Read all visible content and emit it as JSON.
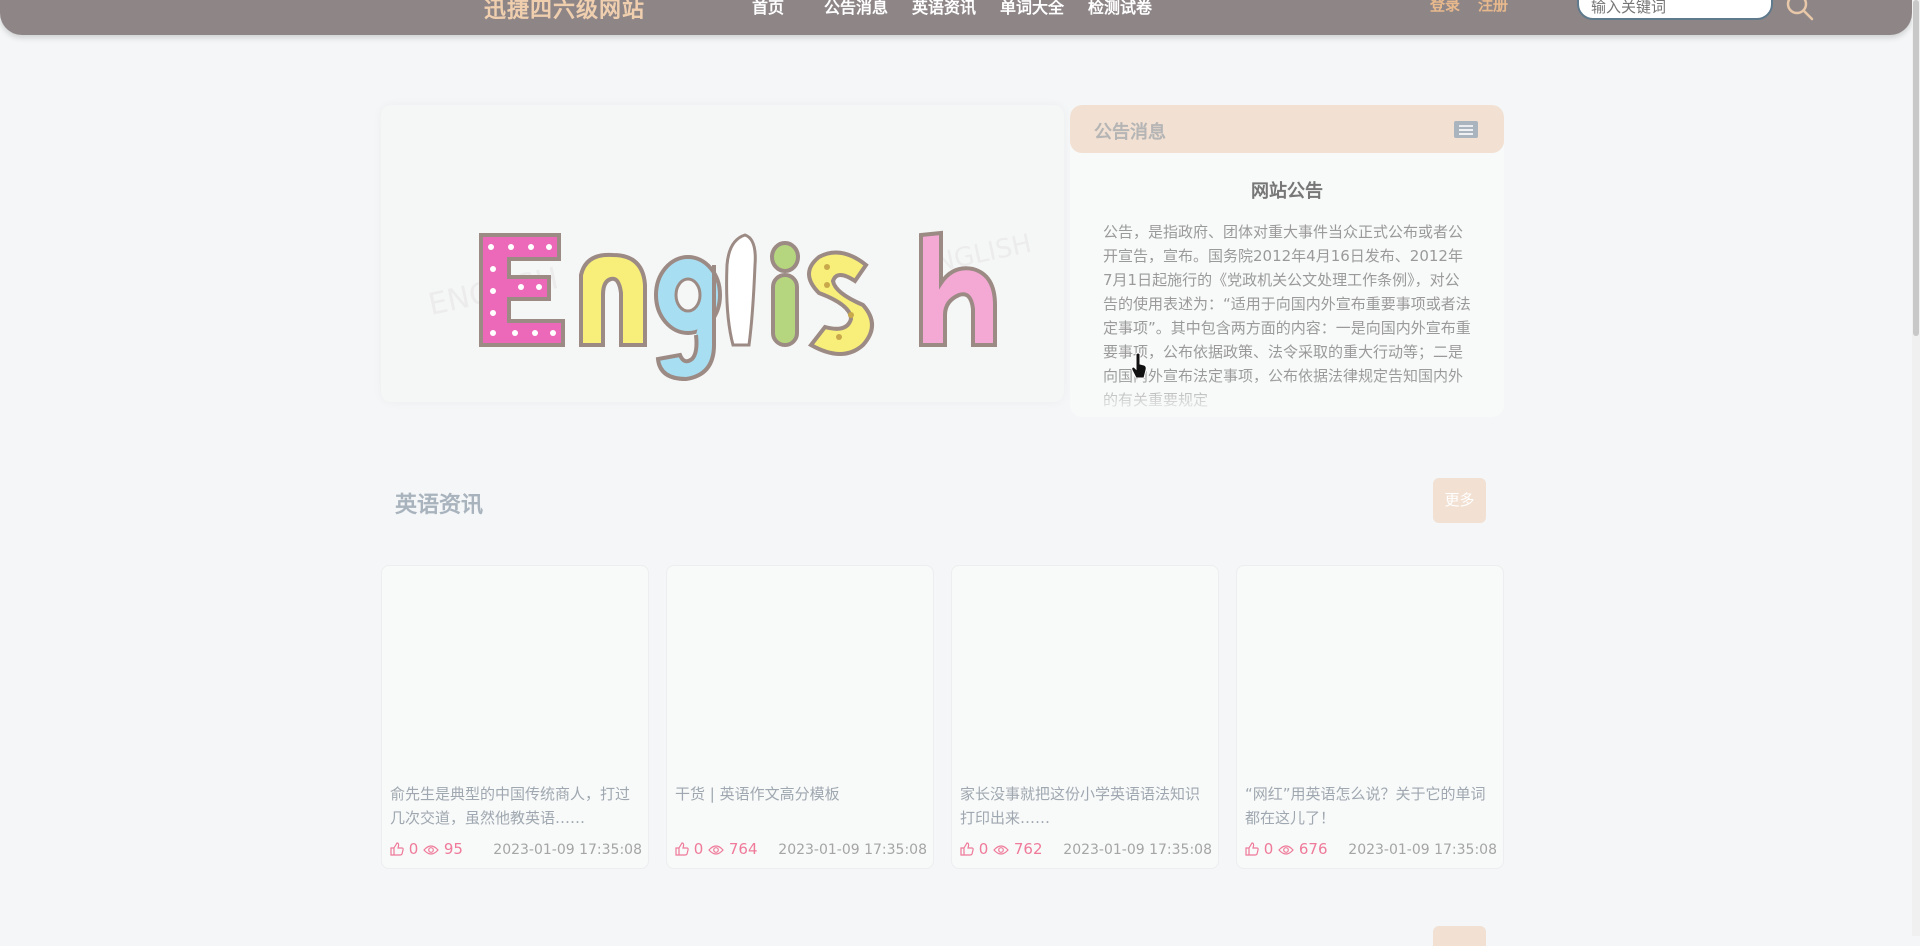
{
  "header": {
    "brand": "迅捷四六级网站",
    "nav": [
      {
        "label": "首页"
      },
      {
        "label": "公告消息"
      },
      {
        "label": "英语资讯"
      },
      {
        "label": "单词大全"
      },
      {
        "label": "检测试卷"
      }
    ],
    "login_label": "登录",
    "register_label": "注册",
    "search_placeholder": "输入关键词"
  },
  "banner": {
    "image_text": "English"
  },
  "notice_panel": {
    "heading": "公告消息",
    "more_icon": "more-icon",
    "title": "网站公告",
    "body": "公告，是指政府、团体对重大事件当众正式公布或者公开宣告，宣布。国务院2012年4月16日发布、2012年7月1日起施行的《党政机关公文处理工作条例》，对公告的使用表述为：“适用于向国内外宣布重要事项或者法定事项”。其中包含两方面的内容：一是向国内外宣布重要事项，公布依据政策、法令采取的重大行动等；二是向国内外宣布法定事项，公布依据法律规定告知国内外的有关重要规定"
  },
  "news_section": {
    "title": "英语资讯",
    "more_label": "更多",
    "cards": [
      {
        "title": "俞先生是典型的中国传统商人，打过几次交道，虽然他教英语……",
        "likes": "0",
        "views": "95",
        "date": "2023-01-09 17:35:08"
      },
      {
        "title": "干货 | 英语作文高分模板",
        "likes": "0",
        "views": "764",
        "date": "2023-01-09 17:35:08"
      },
      {
        "title": "家长没事就把这份小学英语语法知识打印出来……",
        "likes": "0",
        "views": "762",
        "date": "2023-01-09 17:35:08"
      },
      {
        "title": "“网红”用英语怎么说？关于它的单词都在这儿了！",
        "likes": "0",
        "views": "676",
        "date": "2023-01-09 17:35:08"
      }
    ]
  },
  "colors": {
    "header_bg": "#8e8587",
    "accent_peach": "#f2e0d2",
    "stat_pink": "#ef7a9a"
  }
}
